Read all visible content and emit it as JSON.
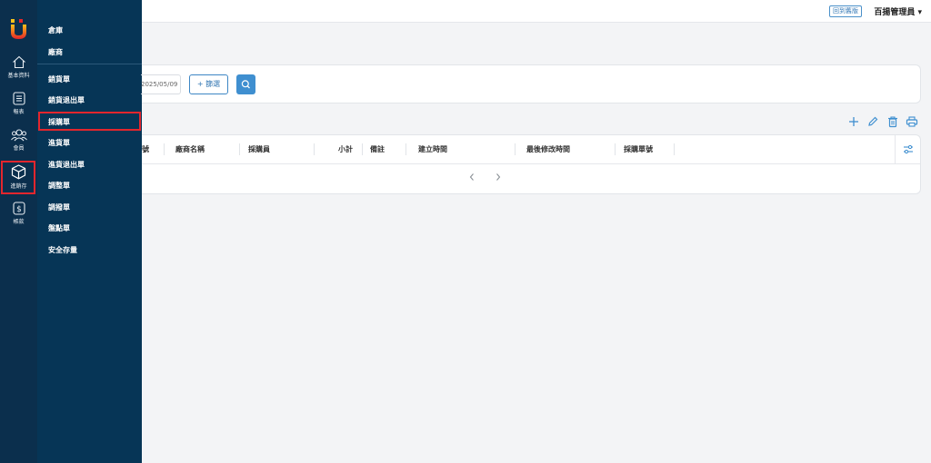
{
  "rail": {
    "items": [
      {
        "label": "基本資料",
        "icon": "home-icon"
      },
      {
        "label": "報表",
        "icon": "report-icon"
      },
      {
        "label": "會員",
        "icon": "members-icon"
      },
      {
        "label": "進銷存",
        "icon": "cube-icon"
      },
      {
        "label": "帳款",
        "icon": "dollar-icon"
      }
    ]
  },
  "submenu": {
    "items": [
      "倉庫",
      "廠商",
      "銷貨單",
      "銷貨退出單",
      "採購單",
      "進貨單",
      "進貨退出單",
      "調整單",
      "調撥單",
      "盤點單",
      "安全存量"
    ]
  },
  "topbar": {
    "back_label": "回到舊版",
    "user_label": "百揚管理員 ▾"
  },
  "filter": {
    "date_value": "2025/05/09",
    "filter_label": "+ 篩選"
  },
  "table": {
    "headers": [
      "號",
      "廠商名稱",
      "採購員",
      "小計",
      "備註",
      "建立時間",
      "最後修改時間",
      "採購單號"
    ]
  },
  "colors": {
    "rail_bg": "#0b2f4d",
    "submenu_bg": "#063556",
    "accent": "#3f8fd0",
    "highlight": "#e3262d"
  }
}
